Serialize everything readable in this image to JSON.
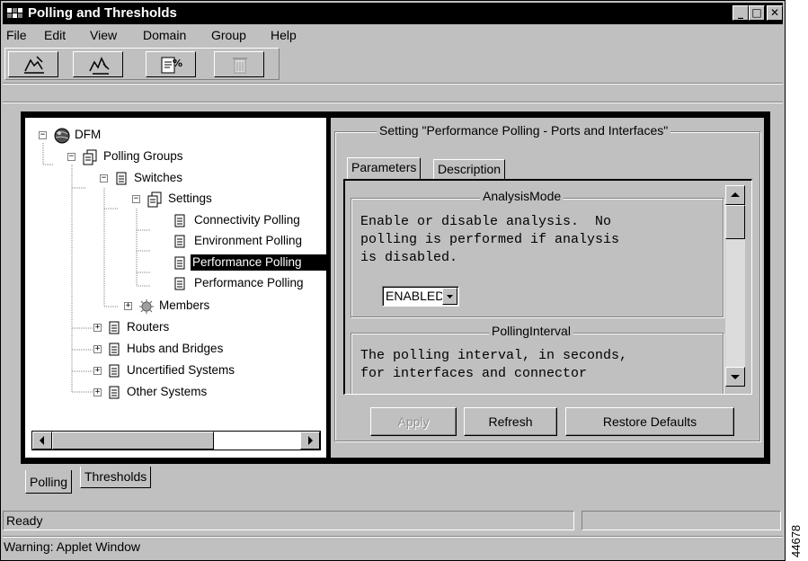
{
  "window": {
    "title": "Polling and Thresholds",
    "controls": {
      "minimize": "_",
      "maximize": "□",
      "close": "✕"
    }
  },
  "menu": [
    "File",
    "Edit",
    "View",
    "Domain",
    "Group",
    "Help"
  ],
  "toolbar": {
    "icons": [
      "edit-polling-icon",
      "edit-thresholds-icon",
      "copy-settings-icon",
      "delete-icon"
    ]
  },
  "tree": {
    "items": [
      {
        "label": "DFM",
        "icon": "globe-icon",
        "toggle": "−"
      },
      {
        "label": "Polling Groups",
        "icon": "groups-icon",
        "toggle": "−"
      },
      {
        "label": "Switches",
        "icon": "document-icon",
        "toggle": "−"
      },
      {
        "label": "Settings",
        "icon": "groups-icon",
        "toggle": "−"
      },
      {
        "label": "Connectivity Polling",
        "icon": "document-icon",
        "toggle": ""
      },
      {
        "label": "Environment Polling",
        "icon": "document-icon",
        "toggle": ""
      },
      {
        "label": "Performance Polling",
        "icon": "document-icon",
        "toggle": "",
        "selected": true
      },
      {
        "label": "Performance Polling",
        "icon": "document-icon",
        "toggle": ""
      },
      {
        "label": "Members",
        "icon": "members-icon",
        "toggle": "+"
      },
      {
        "label": "Routers",
        "icon": "document-icon",
        "toggle": "+"
      },
      {
        "label": "Hubs and Bridges",
        "icon": "document-icon",
        "toggle": "+"
      },
      {
        "label": "Uncertified Systems",
        "icon": "document-icon",
        "toggle": "+"
      },
      {
        "label": "Other Systems",
        "icon": "document-icon",
        "toggle": "+"
      }
    ]
  },
  "setting": {
    "heading": "Setting \"Performance Polling - Ports and Interfaces\"",
    "tabs": [
      "Parameters",
      "Description"
    ],
    "analysis": {
      "legend": "AnalysisMode",
      "lines": [
        "Enable or disable analysis.  No",
        "polling is performed if analysis",
        "is disabled."
      ],
      "select_value": "ENABLED"
    },
    "interval": {
      "legend": "PollingInterval",
      "lines": [
        "The polling interval, in seconds,",
        "for interfaces and connector"
      ]
    },
    "buttons": {
      "apply": "Apply",
      "refresh": "Refresh",
      "restore": "Restore Defaults"
    }
  },
  "bottom_tabs": [
    "Polling",
    "Thresholds"
  ],
  "status": {
    "left": "Ready",
    "right": ""
  },
  "warning": "Warning: Applet Window",
  "figure_number": "44678"
}
